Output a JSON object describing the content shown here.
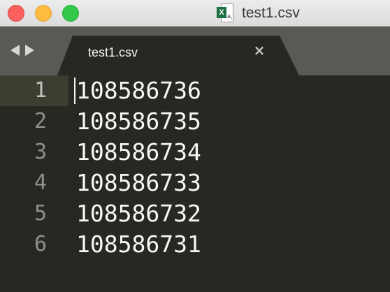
{
  "window": {
    "title": "test1.csv",
    "file_icon": "excel-csv-document-icon",
    "traffic_lights": {
      "close": "#fc605c",
      "minimize": "#fdbc40",
      "maximize": "#34c84a"
    }
  },
  "tabbar": {
    "nav_icons": [
      "back-arrow-icon",
      "forward-arrow-icon"
    ],
    "tabs": [
      {
        "label": "test1.csv",
        "close_symbol": "×",
        "active": true
      }
    ]
  },
  "editor": {
    "theme": {
      "background": "#272822",
      "text": "#f8f8f2",
      "gutter_text": "#8f908a",
      "active_line_gutter": "#3e3d32"
    },
    "active_line": 1,
    "lines": [
      {
        "number": "1",
        "text": "108586736"
      },
      {
        "number": "2",
        "text": "108586735"
      },
      {
        "number": "3",
        "text": "108586734"
      },
      {
        "number": "4",
        "text": "108586733"
      },
      {
        "number": "5",
        "text": "108586732"
      },
      {
        "number": "6",
        "text": "108586731"
      }
    ]
  }
}
